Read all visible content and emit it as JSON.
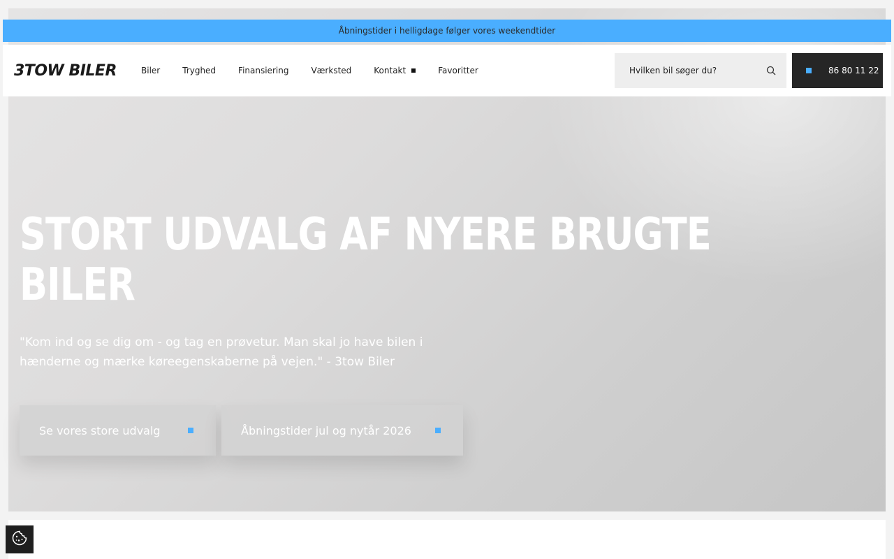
{
  "announcement": {
    "text": "Åbningstider i helligdage følger vores weekendtider"
  },
  "header": {
    "logo_text": "3TOW BILER",
    "nav": [
      {
        "label": "Biler",
        "has_dropdown": false
      },
      {
        "label": "Tryghed",
        "has_dropdown": false
      },
      {
        "label": "Finansiering",
        "has_dropdown": false
      },
      {
        "label": "Værksted",
        "has_dropdown": false
      },
      {
        "label": "Kontakt",
        "has_dropdown": true
      },
      {
        "label": "Favoritter",
        "has_dropdown": false
      }
    ],
    "search": {
      "placeholder": "Hvilken bil søger du?",
      "icon": "search-icon"
    },
    "phone": {
      "number": "86 80 11 22"
    }
  },
  "hero": {
    "title": "STORT UDVALG AF NYERE BRUGTE BILER",
    "quote": "\"Kom ind og se dig om - og tag en prøvetur. Man skal jo have bilen i hænderne og mærke køreegenskaberne på vejen.\" - 3tow Biler",
    "buttons": [
      {
        "label": "Se vores store udvalg"
      },
      {
        "label": "Åbningstider jul og nytår 2026"
      }
    ]
  },
  "cookie": {
    "icon": "cookie-icon"
  },
  "colors": {
    "accent": "#4aaeff",
    "dark": "#262626",
    "hero_bg": "#d6d6d6"
  }
}
